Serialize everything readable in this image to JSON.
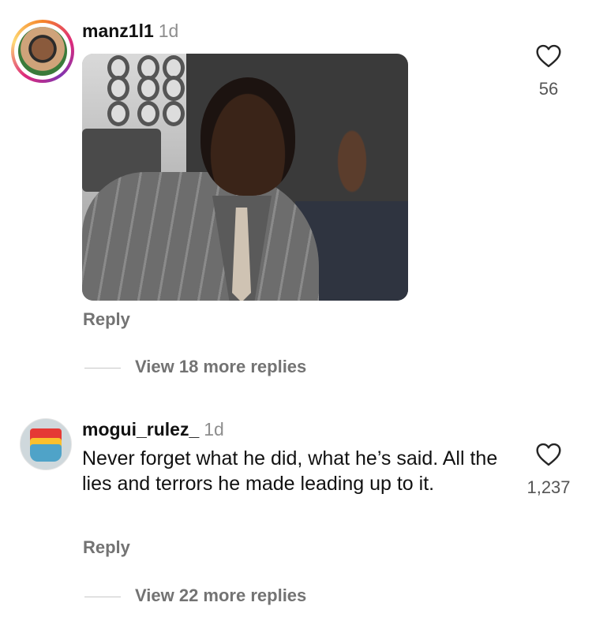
{
  "comments": [
    {
      "username": "manz1l1",
      "time": "1d",
      "likes": "56",
      "reply_label": "Reply",
      "view_replies": "View 18 more replies",
      "icons": {
        "like": "heart-outline-icon"
      }
    },
    {
      "username": "mogui_rulez_",
      "time": "1d",
      "text": "Never forget what he did, what he’s said. All the lies and terrors he made leading up to it.",
      "likes": "1,237",
      "reply_label": "Reply",
      "view_replies": "View 22 more replies",
      "icons": {
        "like": "heart-outline-icon"
      }
    }
  ],
  "colors": {
    "muted": "#737373",
    "text": "#111111",
    "ring_start": "#f58529",
    "ring_mid": "#dd2a7b"
  }
}
